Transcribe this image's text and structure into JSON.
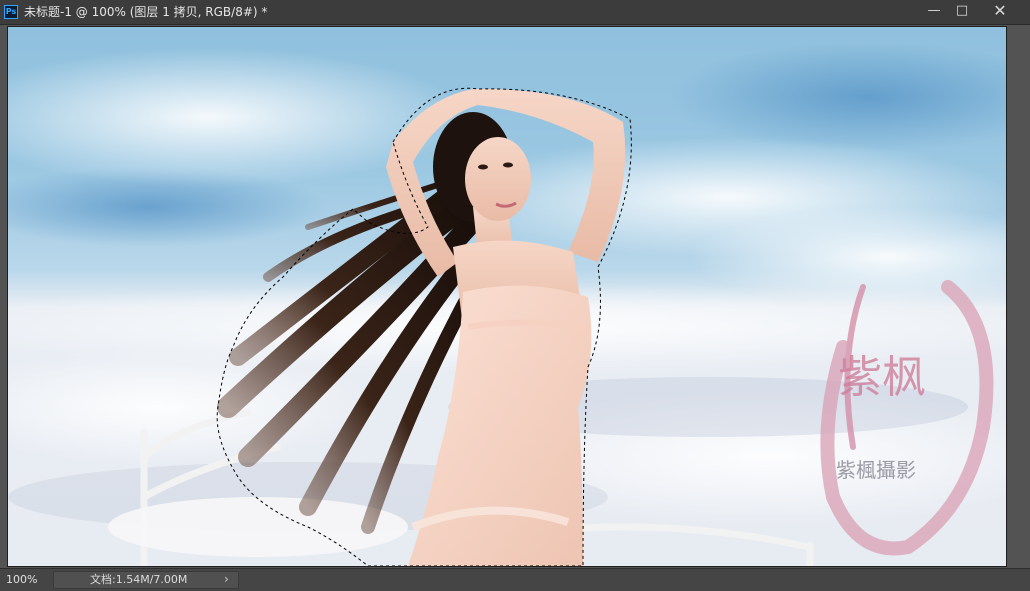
{
  "window": {
    "title": "未标题-1 @ 100% (图层 1 拷贝, RGB/8#) *",
    "app_icon": "Ps",
    "minimize_icon": "minimize-icon",
    "maximize_icon": "maximize-icon",
    "close_icon": "close-icon"
  },
  "canvas": {
    "watermark_brush": "紫枫",
    "watermark_text": "紫楓攝影"
  },
  "statusbar": {
    "zoom": "100%",
    "doc_info": "文档:1.54M/7.00M",
    "arrow": "›"
  },
  "colors": {
    "chrome": "#535353",
    "titlebar": "#3c3c3c",
    "accent": "#31a8ff"
  }
}
